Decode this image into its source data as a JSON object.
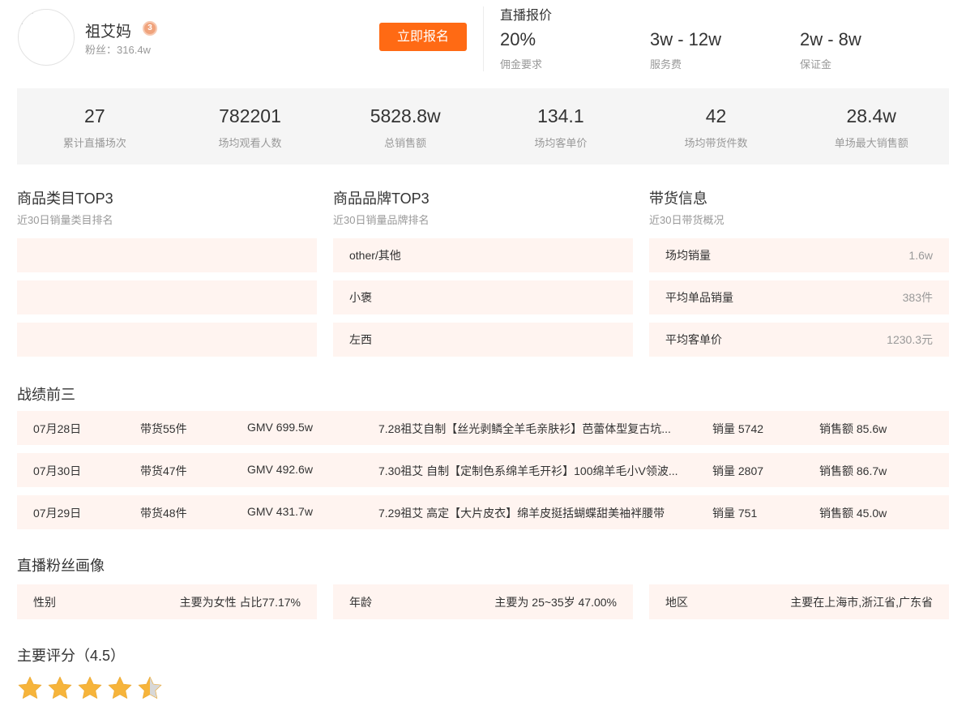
{
  "profile": {
    "name": "祖艾妈",
    "badge": "3",
    "fans_label": "粉丝：",
    "fans_value": "316.4w",
    "signup_button": "立即报名"
  },
  "pricing": {
    "title": "直播报价",
    "items": [
      {
        "value": "20%",
        "label": "佣金要求"
      },
      {
        "value": "3w - 12w",
        "label": "服务费"
      },
      {
        "value": "2w - 8w",
        "label": "保证金"
      }
    ]
  },
  "stats": [
    {
      "value": "27",
      "label": "累计直播场次"
    },
    {
      "value": "782201",
      "label": "场均观看人数"
    },
    {
      "value": "5828.8w",
      "label": "总销售额"
    },
    {
      "value": "134.1",
      "label": "场均客单价"
    },
    {
      "value": "42",
      "label": "场均带货件数"
    },
    {
      "value": "28.4w",
      "label": "单场最大销售额"
    }
  ],
  "category_top3": {
    "title": "商品类目TOP3",
    "subtitle": "近30日销量类目排名",
    "items": [
      "",
      "",
      ""
    ]
  },
  "brand_top3": {
    "title": "商品品牌TOP3",
    "subtitle": "近30日销量品牌排名",
    "items": [
      "other/其他",
      "小褒",
      "左西"
    ]
  },
  "sales_info": {
    "title": "带货信息",
    "subtitle": "近30日带货概况",
    "items": [
      {
        "label": "场均销量",
        "value": "1.6w"
      },
      {
        "label": "平均单品销量",
        "value": "383件"
      },
      {
        "label": "平均客单价",
        "value": "1230.3元"
      }
    ]
  },
  "record": {
    "title": "战绩前三",
    "rows": [
      {
        "date": "07月28日",
        "items": "带货55件",
        "gmv": "GMV 699.5w",
        "title": "7.28祖艾自制【丝光剥鳞全羊毛亲肤衫】芭蕾体型复古坑...",
        "volume": "销量 5742",
        "sales": "销售额 85.6w"
      },
      {
        "date": "07月30日",
        "items": "带货47件",
        "gmv": "GMV 492.6w",
        "title": "7.30祖艾 自制【定制色系绵羊毛开衫】100绵羊毛小V领波...",
        "volume": "销量 2807",
        "sales": "销售额 86.7w"
      },
      {
        "date": "07月29日",
        "items": "带货48件",
        "gmv": "GMV 431.7w",
        "title": "7.29祖艾 高定【大片皮衣】绵羊皮挺括蝴蝶甜美袖袢腰带",
        "volume": "销量 751",
        "sales": "销售额 45.0w"
      }
    ]
  },
  "portrait": {
    "title": "直播粉丝画像",
    "items": [
      {
        "label": "性别",
        "value": "主要为女性 占比77.17%"
      },
      {
        "label": "年龄",
        "value": "主要为 25~35岁 47.00%"
      },
      {
        "label": "地区",
        "value": "主要在上海市,浙江省,广东省"
      }
    ]
  },
  "rating": {
    "title": "主要评分（4.5）",
    "score": 4.5,
    "max": 5,
    "star_color": "#f6b43b",
    "empty_color": "#d8d8d8"
  },
  "colors": {
    "accent": "#ff6a14",
    "row_bg": "#fff4f0",
    "stats_bg": "#f5f5f5"
  }
}
